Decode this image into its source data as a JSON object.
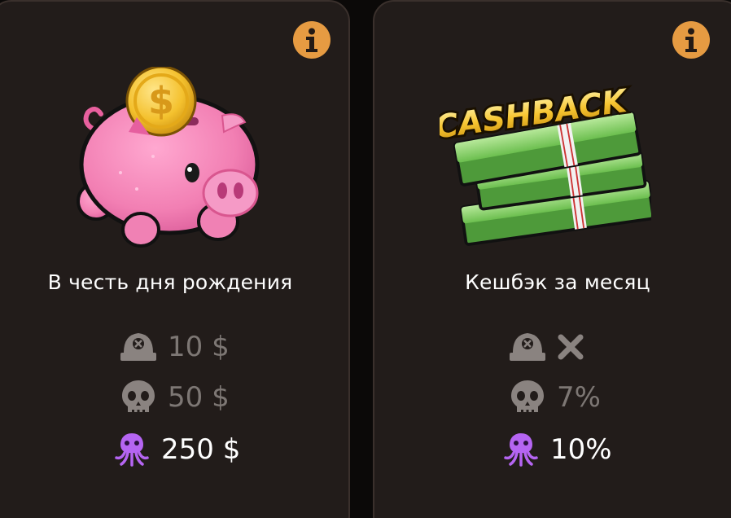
{
  "cards": [
    {
      "title": "В честь дня рождения",
      "illustration": "piggy-bank",
      "tiers": [
        {
          "icon": "pirate-hat-icon",
          "value": "10 $",
          "active": false
        },
        {
          "icon": "skull-icon",
          "value": "50 $",
          "active": false
        },
        {
          "icon": "octopus-icon",
          "value": "250 $",
          "active": true
        }
      ]
    },
    {
      "title": "Кешбэк за месяц",
      "illustration": "cashback-money-stacks",
      "illustration_text": "CASHBACK",
      "tiers": [
        {
          "icon": "pirate-hat-icon",
          "value": "",
          "unavailable_icon": "cross-icon",
          "active": false
        },
        {
          "icon": "skull-icon",
          "value": "7%",
          "active": false
        },
        {
          "icon": "octopus-icon",
          "value": "10%",
          "active": true
        }
      ]
    }
  ],
  "colors": {
    "card_bg": "#221c1a",
    "card_border": "#3a302c",
    "info_accent": "#e69b42",
    "inactive_text": "#7d7774",
    "active_text": "#ffffff",
    "octopus_purple": "#b565f2"
  }
}
